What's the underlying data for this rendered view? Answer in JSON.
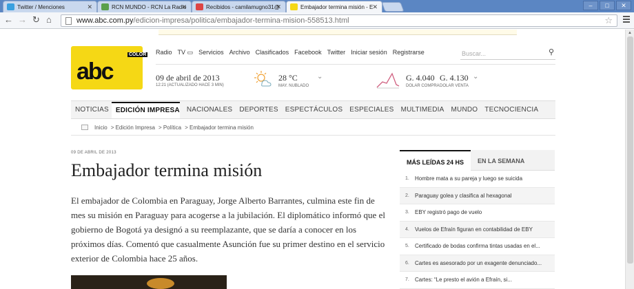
{
  "browser": {
    "tabs": [
      {
        "title": "Twitter / Menciones",
        "icon_color": "#3aa0e0"
      },
      {
        "title": "RCN MUNDO - RCN La Radio",
        "icon_color": "#5aa04c"
      },
      {
        "title": "Recibidos - camilamugno31@",
        "icon_color": "#d44"
      },
      {
        "title": "Embajador termina misión - E",
        "icon_color": "#f5d815"
      }
    ],
    "url_host": "www.abc.com.py",
    "url_path": "/edicion-impresa/politica/embajador-termina-mision-558513.html"
  },
  "site": {
    "logo_text": "abc",
    "logo_tag": "COLOR",
    "topnav": [
      "Radio",
      "TV",
      "Servicios",
      "Archivo",
      "Clasificados",
      "Facebook",
      "Twitter",
      "Iniciar sesión",
      "Registrarse"
    ],
    "search_placeholder": "Buscar...",
    "date": "09 de abril de 2013",
    "date_sub": "12:21 (ACTUALIZADO HACE 3 MIN)",
    "temp": "28 °C",
    "temp_sub": "MAY. NUBLADO",
    "buy": "G. 4.040",
    "buy_sub": "DOLAR COMPRA",
    "sell": "G. 4.130",
    "sell_sub": "DOLAR VENTA",
    "mainnav": [
      "NOTICIAS",
      "EDICIÓN IMPRESA",
      "NACIONALES",
      "DEPORTES",
      "ESPECTÁCULOS",
      "ESPECIALES",
      "MULTIMEDIA",
      "MUNDO",
      "TECNOCIENCIA"
    ],
    "breadcrumb": [
      "Inicio",
      "> Edición Impresa",
      "> Política",
      "> Embajador termina misión"
    ]
  },
  "article": {
    "date": "09 DE ABRIL DE 2013",
    "title": "Embajador termina misión",
    "body": "El embajador de Colombia en Paraguay, Jorge Alberto Barrantes, culmina este fin de mes su misión en Paraguay para acogerse a la jubilación. El diplomático informó que el gobierno de Bogotá ya designó a su reemplazante, que se daría a conocer en los próximos días. Comentó que casualmente Asunción fue su primer destino en el servicio exterior de Colombia hace 25 años."
  },
  "sidebar": {
    "tab_1": "MÁS LEÍDAS 24 HS",
    "tab_2": "EN LA SEMANA",
    "items": [
      {
        "n": "1.",
        "text": "Hombre mata a su pareja y luego se suicida"
      },
      {
        "n": "2.",
        "text": "Paraguay golea y clasifica al hexagonal"
      },
      {
        "n": "3.",
        "text": "EBY registró pago de vuelo"
      },
      {
        "n": "4.",
        "text": "Vuelos de Efraín figuran en contabilidad de EBY"
      },
      {
        "n": "5.",
        "text": "Certificado de bodas confirma tintas usadas en el..."
      },
      {
        "n": "6.",
        "text": "Cartes es asesorado por un exagente denunciado..."
      },
      {
        "n": "7.",
        "text": "Cartes: “Le presto el avión a Efraín, si..."
      }
    ]
  }
}
